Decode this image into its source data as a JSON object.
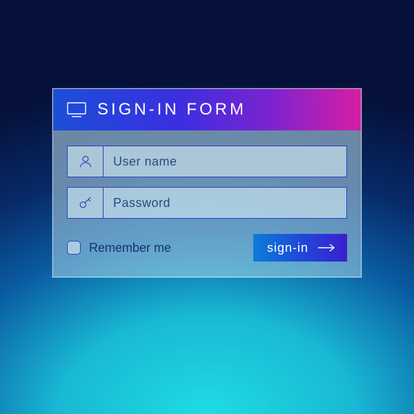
{
  "header": {
    "title": "SIGN-IN FORM"
  },
  "fields": {
    "username_placeholder": "User name",
    "password_placeholder": "Password"
  },
  "footer": {
    "remember_label": "Remember me",
    "signin_label": "sign-in"
  },
  "colors": {
    "accent_border": "#2a3fbf",
    "header_gradient_from": "#1b4fd8",
    "header_gradient_to": "#d81ea5",
    "button_gradient_from": "#0e7bd8",
    "button_gradient_to": "#3a1fd0"
  },
  "icons": {
    "header": "monitor-icon",
    "username": "user-icon",
    "password": "key-icon",
    "submit_arrow": "arrow-right-icon"
  }
}
